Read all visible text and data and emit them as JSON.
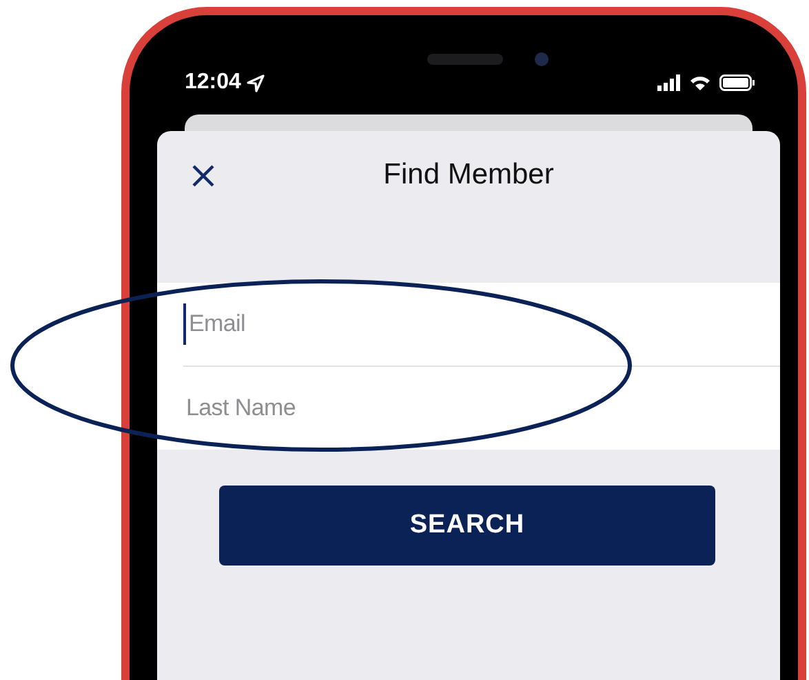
{
  "status_bar": {
    "time": "12:04"
  },
  "sheet": {
    "title": "Find Member",
    "fields": [
      {
        "placeholder": "Email",
        "focused": true
      },
      {
        "placeholder": "Last Name",
        "focused": false
      }
    ],
    "button": "SEARCH"
  }
}
